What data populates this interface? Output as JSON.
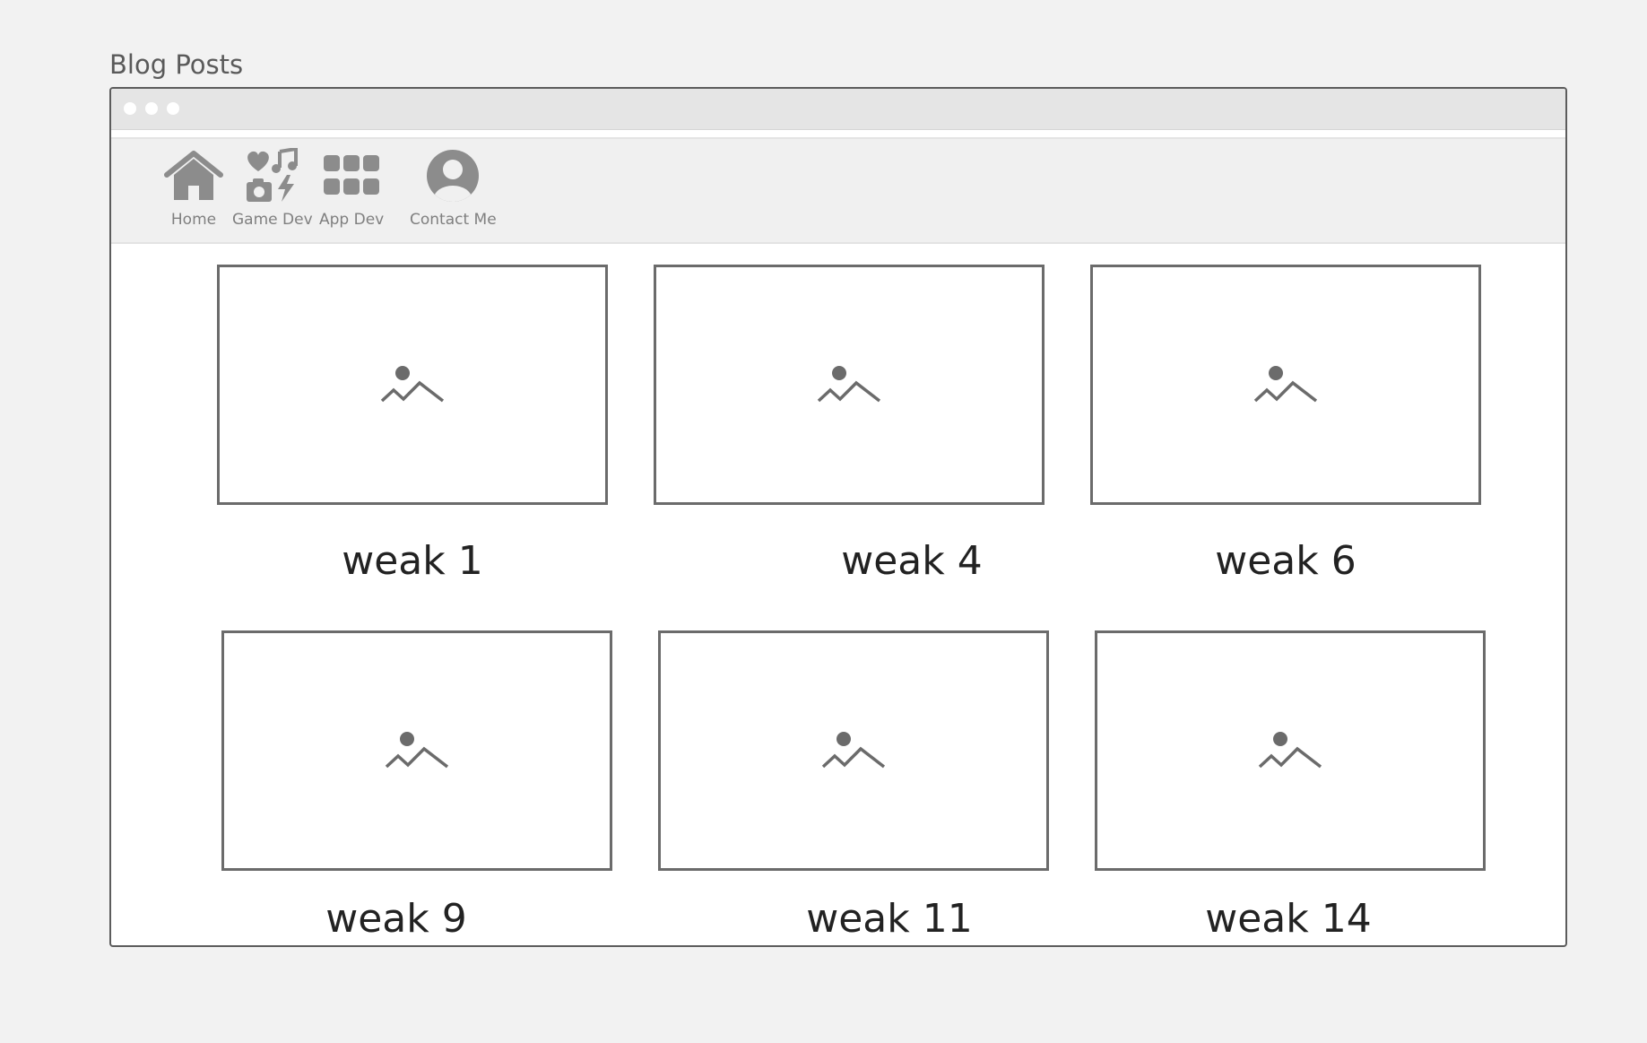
{
  "page": {
    "title": "Blog Posts"
  },
  "nav": {
    "items": [
      {
        "label": "Home",
        "icon": "home-icon"
      },
      {
        "label": "Game Dev",
        "icon": "game-media-icon"
      },
      {
        "label": "App Dev",
        "icon": "apps-grid-icon"
      },
      {
        "label": "Contact Me",
        "icon": "user-circle-icon"
      }
    ]
  },
  "posts": [
    {
      "title": "weak 1"
    },
    {
      "title": "weak 4"
    },
    {
      "title": "weak 6"
    },
    {
      "title": "weak 9"
    },
    {
      "title": "weak 11"
    },
    {
      "title": "weak 14"
    }
  ],
  "colors": {
    "icon": "#8c8c8c",
    "border": "#6b6b6b",
    "background": "#f2f2f2"
  }
}
